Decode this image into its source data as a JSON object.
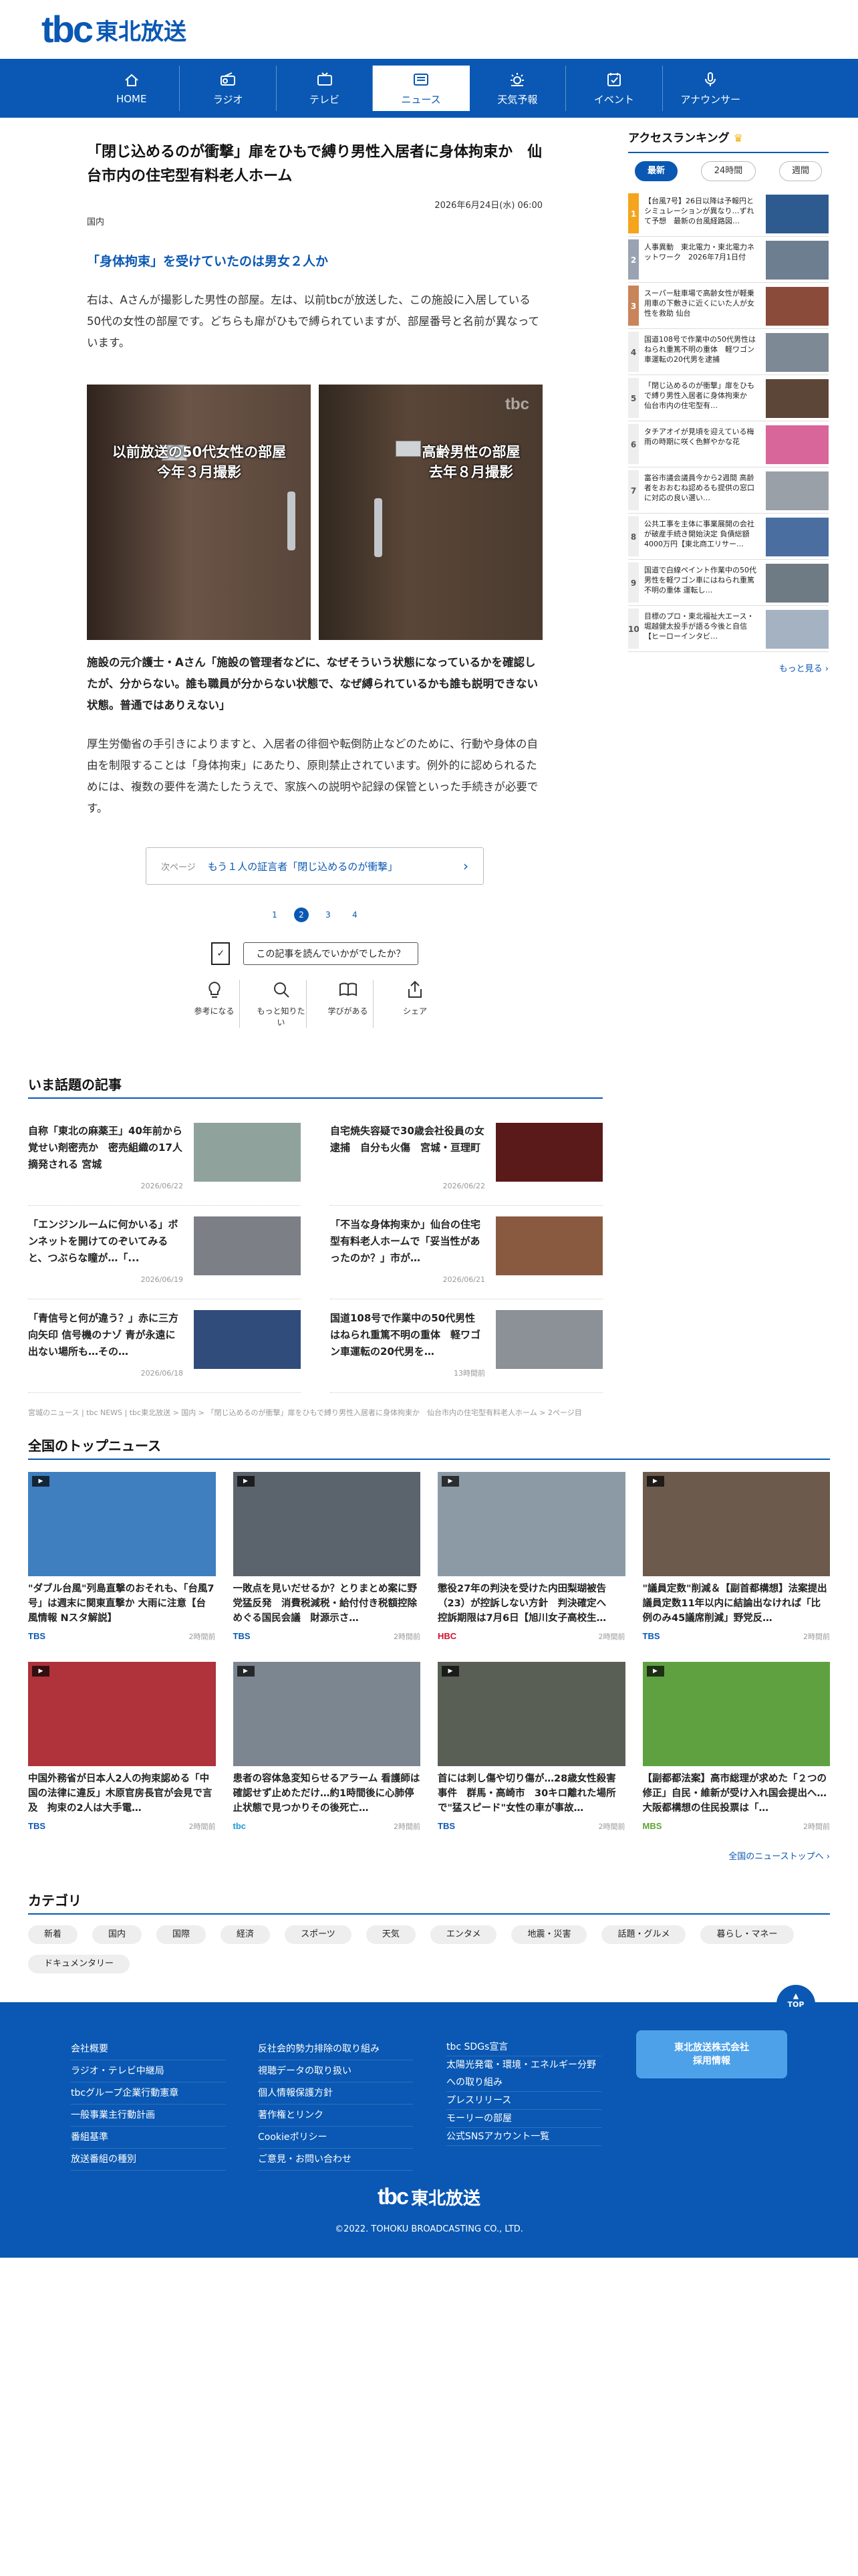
{
  "brand": {
    "logo": "tbc",
    "logo_jp": "東北放送"
  },
  "nav": [
    {
      "label": "HOME",
      "icon": "home-icon"
    },
    {
      "label": "ラジオ",
      "icon": "radio-icon"
    },
    {
      "label": "テレビ",
      "icon": "tv-icon"
    },
    {
      "label": "ニュース",
      "icon": "news-icon",
      "active": true
    },
    {
      "label": "天気予報",
      "icon": "weather-icon"
    },
    {
      "label": "イベント",
      "icon": "event-icon"
    },
    {
      "label": "アナウンサー",
      "icon": "microphone-icon"
    }
  ],
  "article": {
    "title": "「閉じ込めるのが衝撃」扉をひもで縛り男性入居者に身体拘束か　仙台市内の住宅型有料老人ホーム",
    "date": "2026年6月24日(水) 06:00",
    "category": "国内",
    "subheading": "「身体拘束」を受けていたのは男女２人か",
    "para1": "右は、Aさんが撮影した男性の部屋。左は、以前tbcが放送した、この施設に入居している50代の女性の部屋です。どちらも扉がひもで縛られていますが、部屋番号と名前が異なっています。",
    "photo_caption_left_1": "以前放送の50代女性の部屋",
    "photo_caption_left_2": "今年３月撮影",
    "photo_caption_right_1": "高齢男性の部屋",
    "photo_caption_right_2": "去年８月撮影",
    "photo_watermark": "tbc",
    "quote": "施設の元介護士・Aさん「施設の管理者などに、なぜそういう状態になっているかを確認したが、分からない。誰も職員が分からない状態で、なぜ縛られているかも誰も説明できない状態。普通ではありえない」",
    "para2": "厚生労働省の手引きによりますと、入居者の徘徊や転倒防止などのために、行動や身体の自由を制限することは「身体拘束」にあたり、原則禁止されています。例外的に認められるためには、複数の要件を満たしたうえで、家族への説明や記録の保管といった手続きが必要です。",
    "next_label": "次ページ",
    "next_text": "もう１人の証言者「閉じ込めるのが衝撃」",
    "pages": [
      "1",
      "2",
      "3",
      "4"
    ],
    "current_page": "2",
    "feedback_q": "この記事を読んでいかがでしたか？",
    "reactions": [
      {
        "label": "参考になる",
        "icon": "lightbulb-icon"
      },
      {
        "label": "もっと知りたい",
        "icon": "magnifier-icon"
      },
      {
        "label": "学びがある",
        "icon": "book-icon"
      },
      {
        "label": "シェア",
        "icon": "share-icon"
      }
    ]
  },
  "ranking": {
    "title": "アクセスランキング",
    "tabs": [
      "最新",
      "24時間",
      "週間"
    ],
    "active_tab": "最新",
    "items": [
      {
        "rank": "1",
        "text": "【台風7号】26日以降は予報円とシミュレーションが異なり…ずれて予想　最新の台風経路図…",
        "thumb": "#2e5b8f"
      },
      {
        "rank": "2",
        "text": "人事異動　東北電力・東北電力ネットワーク　2026年7月1日付",
        "thumb": "#6d7e91"
      },
      {
        "rank": "3",
        "text": "スーパー駐車場で高齢女性が軽乗用車の下敷きに近くにいた人が女性を救助 仙台",
        "thumb": "#8a4b3a"
      },
      {
        "rank": "4",
        "text": "国道108号で作業中の50代男性はねられ重篤不明の重体　軽ワゴン車運転の20代男を逮捕",
        "thumb": "#7d8a95"
      },
      {
        "rank": "5",
        "text": "「閉じ込めるのが衝撃」扉をひもで縛り男性入居者に身体拘束か　仙台市内の住宅型有…",
        "thumb": "#5c4638"
      },
      {
        "rank": "6",
        "text": "タチアオイが見頃を迎えている梅雨の時期に咲く色鮮やかな花",
        "thumb": "#d9669a"
      },
      {
        "rank": "7",
        "text": "富谷市議会議員今から2週間 高齢者をおおむね認めるも提供の窓口に対応の良い選い…",
        "thumb": "#99a0a8"
      },
      {
        "rank": "8",
        "text": "公共工事を主体に事業展開の会社が破産手続き開始決定 負債総額4000万円【東北商工リサー…",
        "thumb": "#4a6ea0"
      },
      {
        "rank": "9",
        "text": "国道で白線ペイント作業中の50代男性を軽ワゴン車にはねられ重篤不明の重体 運転し…",
        "thumb": "#6e7a84"
      },
      {
        "rank": "10",
        "text": "目標のプロ・東北福祉大エース・堀越健太投手が語る今後と自信【ヒーローインタビ…",
        "thumb": "#a4b2c2"
      }
    ],
    "more": "もっと見る"
  },
  "hot": {
    "title": "いま話題の記事",
    "items": [
      {
        "text": "自称「東北の麻薬王」40年前から覚せい剤密売か　密売組織の17人摘発される 宮城",
        "date": "2026/06/22",
        "thumb": "#8fa39c"
      },
      {
        "text": "自宅焼失容疑で30歳会社役員の女逮捕　自分も火傷　宮城・亘理町",
        "date": "2026/06/22",
        "thumb": "#5a1a1a"
      },
      {
        "text": "「エンジンルームに何かいる」ボンネットを開けてのぞいてみると、つぶらな瞳が…「...",
        "date": "2026/06/19",
        "thumb": "#7d7f86"
      },
      {
        "text": "「不当な身体拘束か」仙台の住宅型有料老人ホームで「妥当性があったのか？」市が…",
        "date": "2026/06/21",
        "thumb": "#8a5a40"
      },
      {
        "text": "「青信号と何が違う？」赤に三方向矢印 信号機のナゾ 青が永遠に出ない場所も…その…",
        "date": "2026/06/18",
        "thumb": "#2f4c7a"
      },
      {
        "text": "国道108号で作業中の50代男性はねられ重篤不明の重体　軽ワゴン車運転の20代男を…",
        "date": "13時間前",
        "thumb": "#8b9196"
      }
    ]
  },
  "breadcrumb": "宮城のニュース | tbc NEWS | tbc東北放送 > 国内 > 「閉じ込めるのが衝撃」扉をひもで縛り男性入居者に身体拘束か　仙台市内の住宅型有料老人ホーム > 2ページ目",
  "top_news": {
    "title": "全国のトップニュース",
    "items": [
      {
        "text": "\"ダブル台風\"列島直撃のおそれも、「台風7号」は週末に関東直撃か 大雨に注意【台風情報 Nスタ解説】",
        "src": "TBS",
        "src_color": "#0a58b3",
        "ago": "2時間前",
        "thumb": "#3f7fc0"
      },
      {
        "text": "一敗点を見いだせるか？とりまとめ案に野党猛反発　消費税減税・給付付き税額控除めぐる国民会議　財源示さ…",
        "src": "TBS",
        "src_color": "#0a58b3",
        "ago": "2時間前",
        "thumb": "#5b636c"
      },
      {
        "text": "懲役27年の判決を受けた内田梨瑚被告（23）が控訴しない方針　判決確定へ　控訴期限は7月6日【旭川女子高校生…",
        "src": "HBC",
        "src_color": "#d0112b",
        "ago": "2時間前",
        "thumb": "#8c9aa6"
      },
      {
        "text": "\"議員定数\"削減＆【副首都構想】法案提出　議員定数11年以内に結論出なければ「比例のみ45議席削減」野党反…",
        "src": "TBS",
        "src_color": "#0a58b3",
        "ago": "2時間前",
        "thumb": "#6c5a4c"
      },
      {
        "text": "中国外務省が日本人2人の拘束認める「中国の法律に違反」木原官房長官が会見で言及　拘束の2人は大手電…",
        "src": "TBS",
        "src_color": "#0a58b3",
        "ago": "2時間前",
        "thumb": "#b0323a"
      },
      {
        "text": "患者の容体急変知らせるアラーム 看護師は確認せず止めただけ…約1時間後に心肺停止状態で見つかりその後死亡…",
        "src": "tbc",
        "src_color": "#1b9bd6",
        "ago": "2時間前",
        "thumb": "#7c8690"
      },
      {
        "text": "首には刺し傷や切り傷が…28歳女性殺害事件　群馬・高崎市　30キロ離れた場所で\"猛スピード\"女性の車が事故…",
        "src": "TBS",
        "src_color": "#0a58b3",
        "ago": "2時間前",
        "thumb": "#595f55"
      },
      {
        "text": "【副都都法案】高市総理が求めた「２つの修正」自民・維新が受け入れ国会提出へ…大阪都構想の住民投票は「…",
        "src": "MBS",
        "src_color": "#5aa532",
        "ago": "2時間前",
        "thumb": "#5fa140"
      }
    ],
    "more": "全国のニューストップへ"
  },
  "categories": {
    "title": "カテゴリ",
    "items": [
      "新着",
      "国内",
      "国際",
      "経済",
      "スポーツ",
      "天気",
      "エンタメ",
      "地震・災害",
      "話題・グルメ",
      "暮らし・マネー",
      "ドキュメンタリー"
    ]
  },
  "footer": {
    "top_label": "TOP",
    "col1": [
      "会社概要",
      "ラジオ・テレビ中継局",
      "tbcグループ企業行動憲章",
      "一般事業主行動計画",
      "番組基準",
      "放送番組の種別"
    ],
    "col2": [
      "反社会的勢力排除の取り組み",
      "視聴データの取り扱い",
      "個人情報保護方針",
      "著作権とリンク",
      "Cookieポリシー",
      "ご意見・お問い合わせ"
    ],
    "col3": [
      "tbc SDGs宣言",
      "太陽光発電・環境・エネルギー分野への取り組み",
      "プレスリリース",
      "モーリーの部屋",
      "公式SNSアカウント一覧"
    ],
    "recruit_1": "東北放送株式会社",
    "recruit_2": "採用情報",
    "logo": "tbc",
    "logo_jp": "東北放送",
    "copyright": "©2022. TOHOKU BROADCASTING CO., LTD."
  },
  "colors": {
    "brand": "#0a58b3",
    "accent_light": "#4da1e8",
    "rank_gold": "#f4a51d"
  }
}
